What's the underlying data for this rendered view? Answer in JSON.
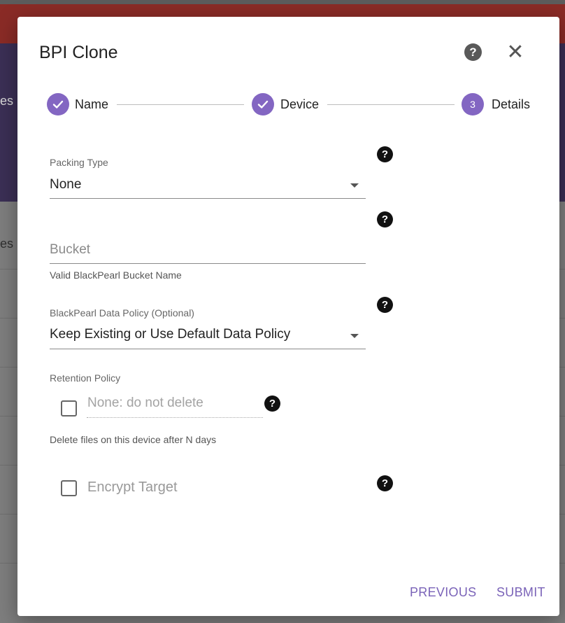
{
  "background": {
    "fragment_top": "es",
    "fragment_bottom": "es"
  },
  "dialog": {
    "title": "BPI Clone",
    "help_icon": "help-circle-icon",
    "close_icon": "close-icon",
    "close_glyph": "✕"
  },
  "stepper": {
    "steps": [
      {
        "label": "Name",
        "state": "complete",
        "icon": "check-icon"
      },
      {
        "label": "Device",
        "state": "complete",
        "icon": "check-icon"
      },
      {
        "label": "Details",
        "state": "active",
        "number": "3"
      }
    ],
    "accent_color": "#8366c2"
  },
  "form": {
    "packing_type": {
      "label": "Packing Type",
      "value": "None"
    },
    "bucket": {
      "placeholder": "Bucket",
      "hint": "Valid BlackPearl Bucket Name"
    },
    "data_policy": {
      "label": "BlackPearl Data Policy (Optional)",
      "value": "Keep Existing or Use Default Data Policy"
    },
    "retention": {
      "label": "Retention Policy",
      "checked": false,
      "placeholder": "None: do not delete",
      "hint": "Delete files on this device after N days"
    },
    "encrypt": {
      "label": "Encrypt Target",
      "checked": false
    },
    "help_glyph": "?"
  },
  "actions": {
    "previous": "PREVIOUS",
    "submit": "SUBMIT",
    "color": "#7a63b8"
  }
}
